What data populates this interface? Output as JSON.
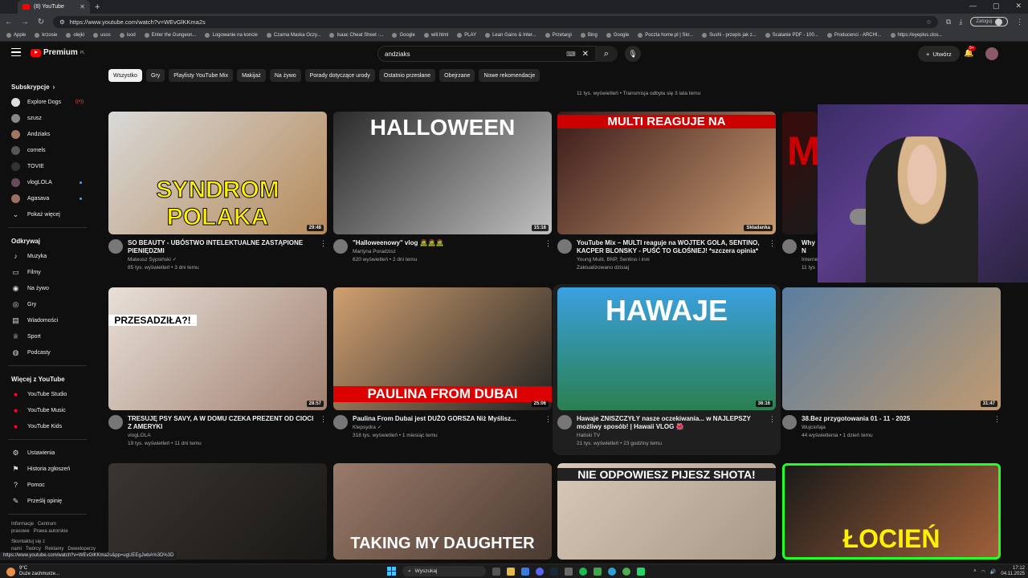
{
  "browser": {
    "tab_title": "(8) YouTube",
    "url": "https://www.youtube.com/watch?v=WEvGlKKma2s",
    "profile_label": "Zaloguj",
    "bookmarks": [
      "Apple",
      "krzosie",
      "olejki",
      "usos",
      "isod",
      "Enter the Gungeon...",
      "Logowanie na koncie",
      "Czarna Maska Oczy...",
      "Isaac Cheat Sheet -...",
      "Google",
      "will.html",
      "PLAY",
      "Lean Gains & Inter...",
      "Przetargi",
      "Bing",
      "Google",
      "Poczta home.pl | Skr...",
      "Sushi - przepis jak z...",
      "Scalanie PDF - 100...",
      "Producenci - ARCHI...",
      "https://eyeplus.clos..."
    ]
  },
  "header": {
    "logo": "Premium",
    "logo_sup": "PL",
    "search_query": "andziaks",
    "create_label": "Utwórz",
    "notif_count": "9+"
  },
  "chips": [
    "Wszystko",
    "Gry",
    "Playlisty YouTube Mix",
    "Makijaż",
    "Na żywo",
    "Porady dotyczące urody",
    "Ostatnio przesłane",
    "Obejrzane",
    "Nowe rekomendacje"
  ],
  "sidebar": {
    "subs_title": "Subskrypcje",
    "subs": [
      "Explore Dogs",
      "szusz",
      "Andziaks",
      "cornels",
      "TOVIE",
      "vlogLOLA",
      "Agasava"
    ],
    "show_more": "Pokaż więcej",
    "explore_title": "Odkrywaj",
    "explore": [
      "Muzyka",
      "Filmy",
      "Na żywo",
      "Gry",
      "Wiadomości",
      "Sport",
      "Podcasty"
    ],
    "more_title": "Więcej z YouTube",
    "more": [
      "YouTube Studio",
      "YouTube Music",
      "YouTube Kids"
    ],
    "settings": [
      "Ustawienia",
      "Historia zgłoszeń",
      "Pomoc",
      "Prześlij opinię"
    ],
    "footer1": [
      "Informacje",
      "Centrum prasowe",
      "Prawa autorskie"
    ],
    "footer2": [
      "Skontaktuj się z nami",
      "Twórcy",
      "Reklamy",
      "Deweloperzy"
    ]
  },
  "top_row_meta": {
    "col3": "11 tys. wyświetleń • Transmisja odbyła się 3 lata temu"
  },
  "videos": [
    {
      "title": "SO BEAUTY - UBÓSTWO INTELEKTUALNE ZASTĄPIONE PIENIĘDZMI",
      "channel": "Mateusz Sypsiński ✓",
      "stats": "85 tys. wyświetleń • 3 dni temu",
      "duration": "29:48",
      "overlay": "SYNDROM POLAKA"
    },
    {
      "title": "\"Halloweenowy\" vlog 🧟🧟🧟",
      "channel": "Martyna Poradzisz",
      "stats": "620 wyświetleń • 2 dni temu",
      "duration": "15:16",
      "overlay": "HALLOWEEN"
    },
    {
      "title": "YouTube Mix – MULTI reaguje na WOJTEK GOLA, SENTINO, KACPER BLONSKY - PUŚĆ TO GŁOŚNIEJ! *szczera opinia*",
      "channel": "Young Multi, BNP, Sentino i inni",
      "stats": "Zaktualizowano dzisiaj",
      "duration": "Składanka",
      "overlay": "MULTI REAGUJE NA"
    },
    {
      "title": "Why N",
      "channel": "Interne",
      "stats": "11 tys",
      "duration": "",
      "overlay": "M"
    },
    {
      "title": "TRESUJĘ PSY SAVY, A W DOMU CZEKA PREZENT OD CIOCI Z AMERYKI",
      "channel": "vlogLOLA",
      "stats": "19 tys. wyświetleń • 11 dni temu",
      "duration": "28:57",
      "overlay": "PRZESADZIŁA?!"
    },
    {
      "title": "Paulina From Dubai jest DUŻO GORSZA Niż Myślisz...",
      "channel": "Klepsydra ✓",
      "stats": "318 tys. wyświetleń • 1 miesiąc temu",
      "duration": "25:06",
      "overlay": "PAULINA FROM DUBAI"
    },
    {
      "title": "Hawaje ZNISZCZYŁY nasze oczekiwania... w NAJLEPSZY możliwy sposób! | Hawaii VLOG 🌺",
      "channel": "Haliski TV",
      "stats": "21 tys. wyświetleń • 23 godziny temu",
      "duration": "36:16",
      "overlay": "HAWAJE"
    },
    {
      "title": "38.Bez przygotowania 01 - 11 - 2025",
      "channel": "Wujciofaja",
      "stats": "44 wyświetlenia • 1 dzień temu",
      "duration": "31:47",
      "overlay": ""
    },
    {
      "title": "",
      "channel": "",
      "stats": "",
      "duration": "",
      "overlay": ""
    },
    {
      "title": "",
      "channel": "",
      "stats": "",
      "duration": "",
      "overlay": "TAKING MY DAUGHTER"
    },
    {
      "title": "",
      "channel": "",
      "stats": "",
      "duration": "",
      "overlay": "NIE ODPOWIESZ PIJESZ SHOTA!"
    },
    {
      "title": "",
      "channel": "",
      "stats": "",
      "duration": "",
      "overlay": "ŁOCIEŃ"
    }
  ],
  "status_url": "https://www.youtube.com/watch?v=WEvGlKKma2s&pp=ugUEEgJwbA%3D%3D",
  "taskbar": {
    "temp": "9°C",
    "weather": "Duże zachmurze...",
    "search": "Wyszukaj",
    "time": "17:12",
    "date": "04.11.2025"
  },
  "colors": {
    "bg": "#0f0f0f",
    "accent": "#ff0000",
    "chip": "#272727"
  }
}
